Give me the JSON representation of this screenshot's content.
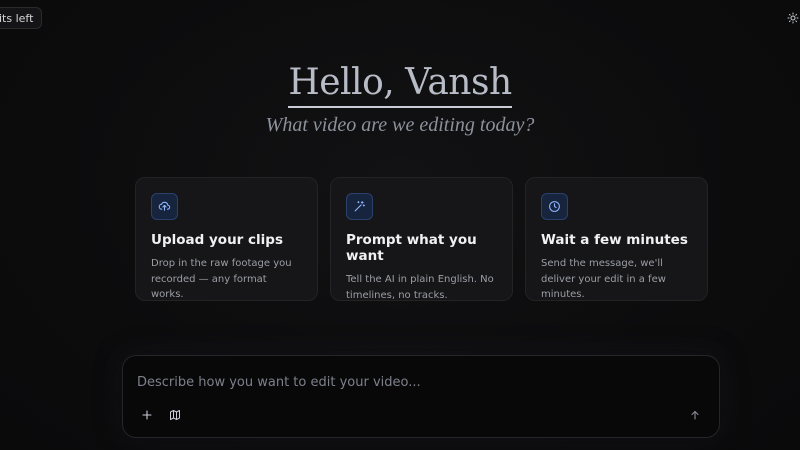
{
  "credits": {
    "label": "its left"
  },
  "greeting": {
    "title": "Hello, Vansh",
    "subtitle": "What video are we editing today?"
  },
  "cards": [
    {
      "icon": "upload-cloud-icon",
      "title": "Upload your clips",
      "description": "Drop in the raw footage you recorded — any format works."
    },
    {
      "icon": "magic-wand-icon",
      "title": "Prompt what you want",
      "description": "Tell the AI in plain English. No timelines, no tracks."
    },
    {
      "icon": "clock-icon",
      "title": "Wait a few minutes",
      "description": "Send the message, we'll deliver your edit in a few minutes."
    }
  ],
  "prompt": {
    "placeholder": "Describe how you want to edit your video...",
    "value": ""
  },
  "colors": {
    "background": "#0c0c0d",
    "card_bg": "#161618",
    "icon_bg": "#17243d",
    "icon_accent": "#8fb4ff"
  }
}
